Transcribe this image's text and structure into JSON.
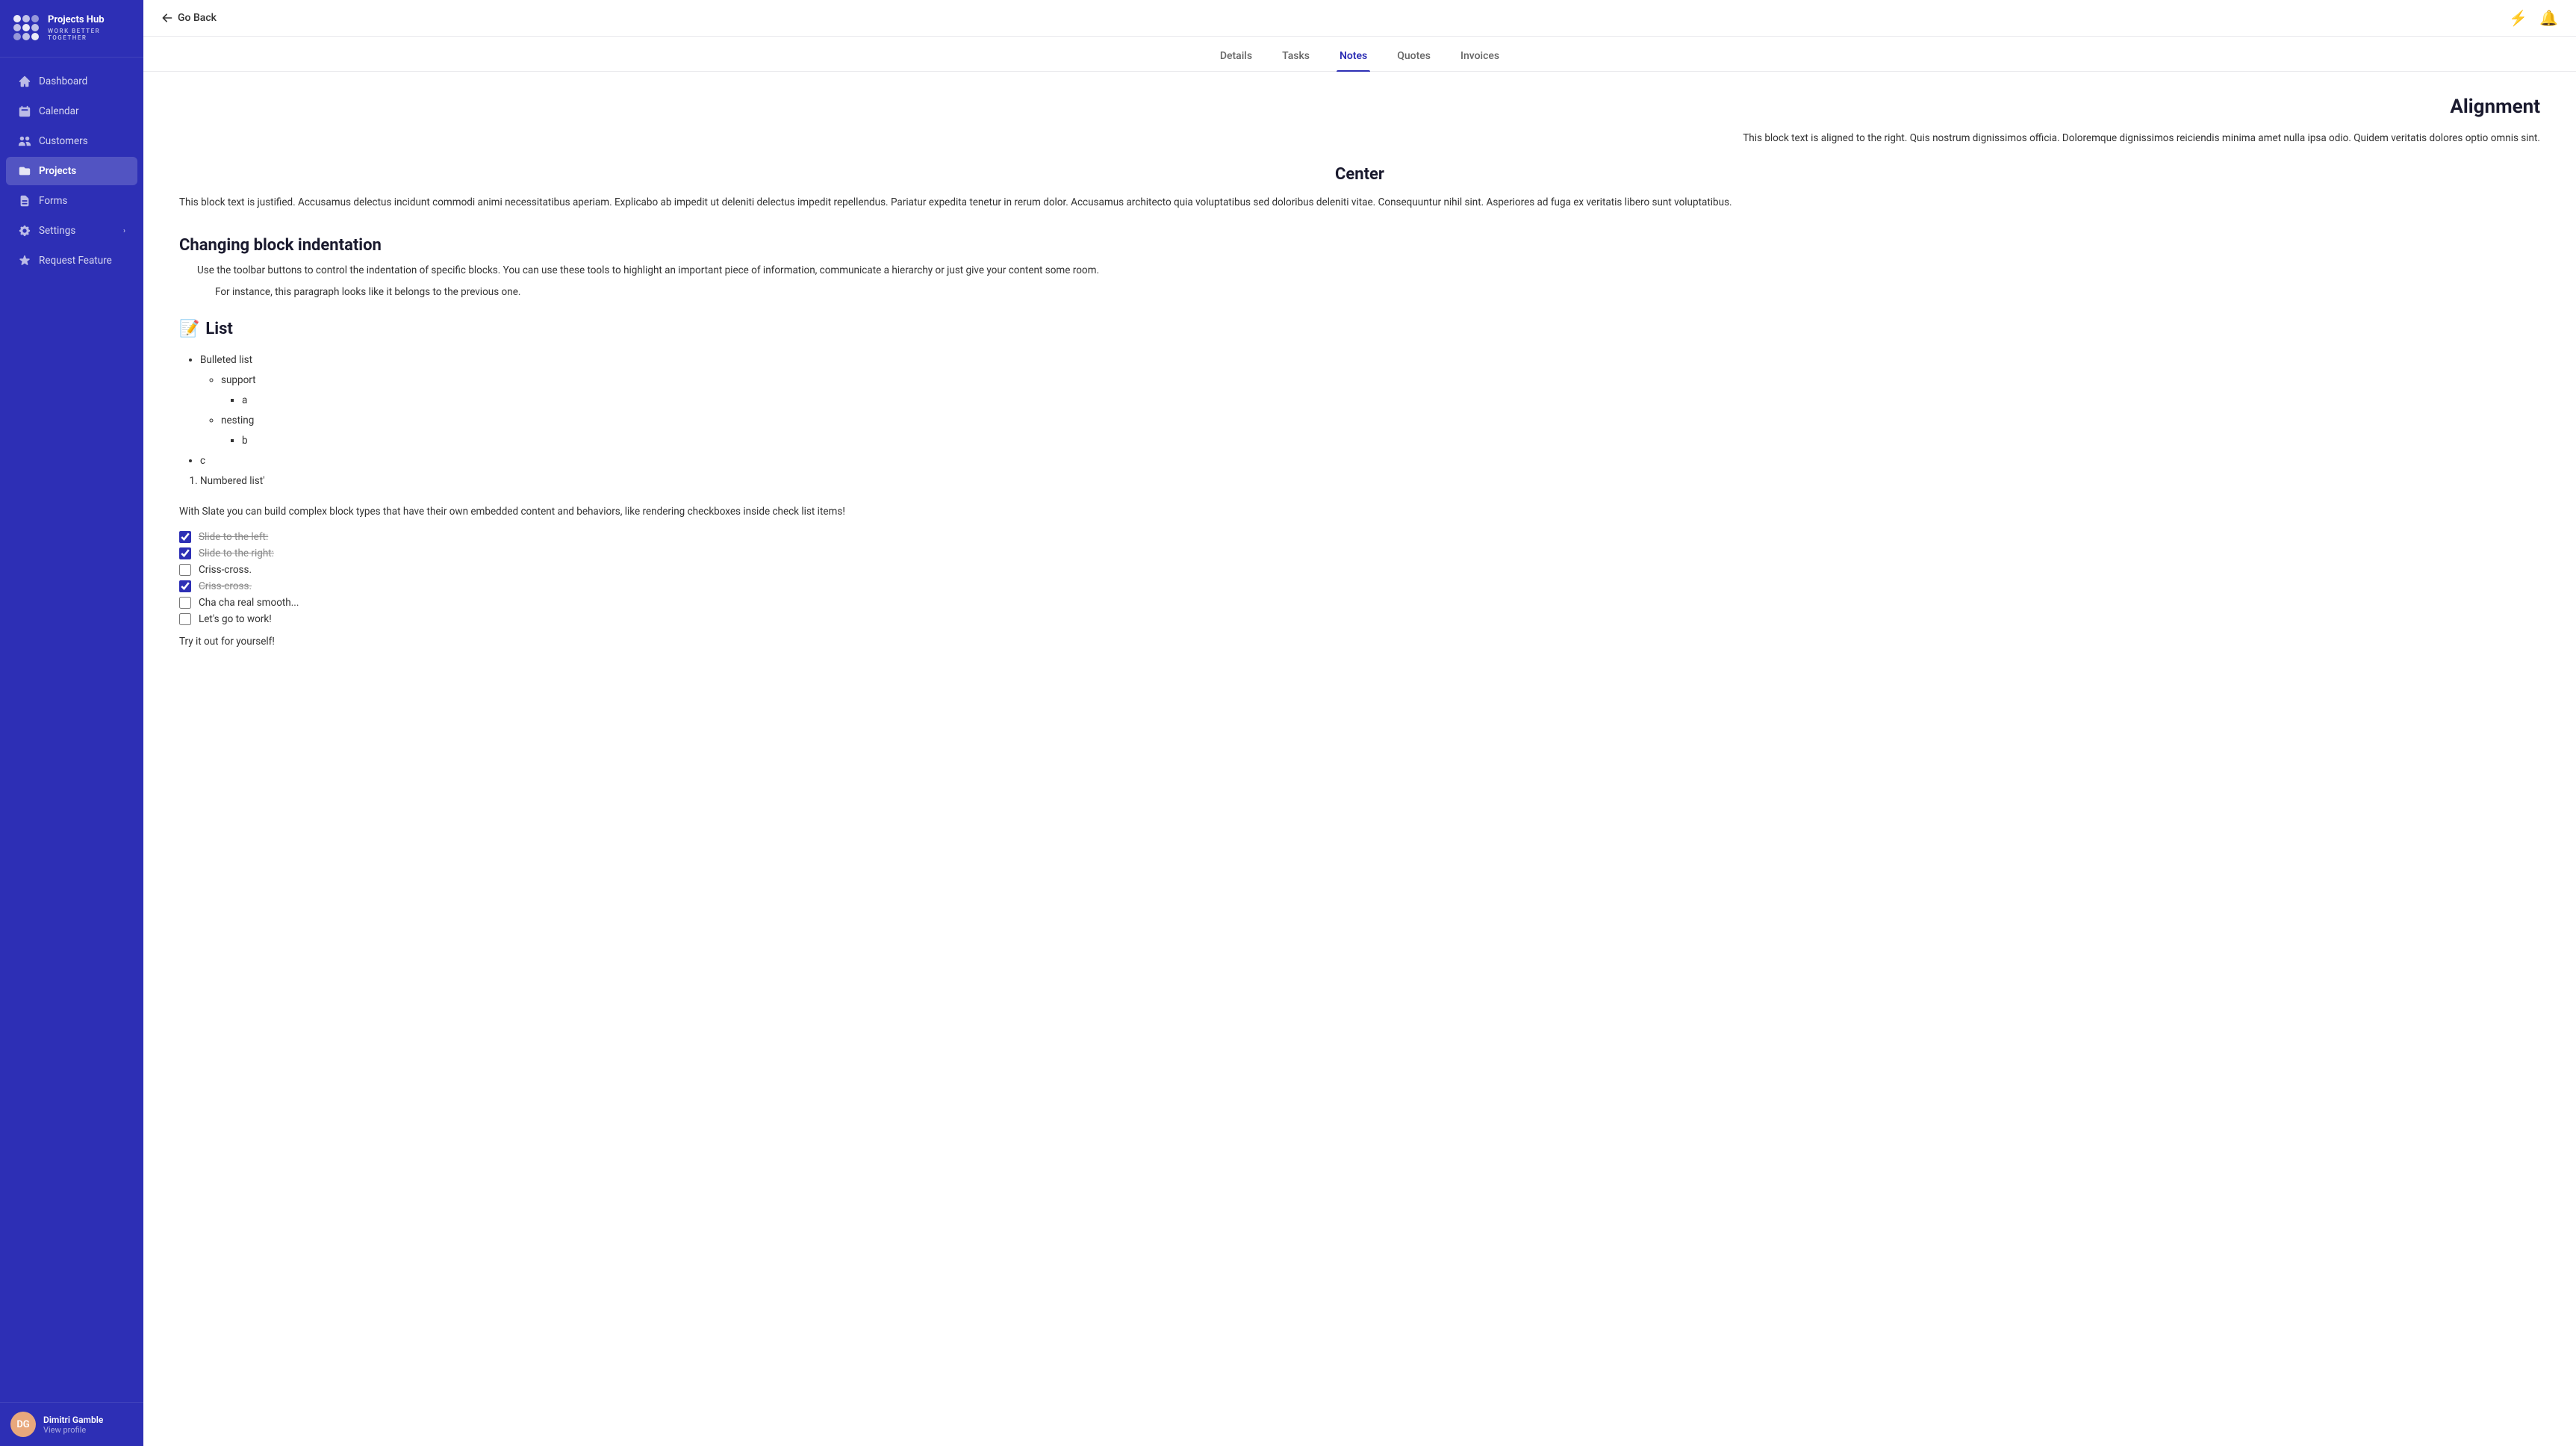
{
  "app": {
    "name": "Projects Hub",
    "tagline": "WORK BETTER TOGETHER"
  },
  "topbar": {
    "back_label": "Go Back"
  },
  "tabs": [
    {
      "id": "details",
      "label": "Details"
    },
    {
      "id": "tasks",
      "label": "Tasks"
    },
    {
      "id": "notes",
      "label": "Notes"
    },
    {
      "id": "quotes",
      "label": "Quotes"
    },
    {
      "id": "invoices",
      "label": "Invoices"
    }
  ],
  "sidebar": {
    "items": [
      {
        "id": "dashboard",
        "label": "Dashboard",
        "icon": "home"
      },
      {
        "id": "calendar",
        "label": "Calendar",
        "icon": "calendar"
      },
      {
        "id": "customers",
        "label": "Customers",
        "icon": "users"
      },
      {
        "id": "projects",
        "label": "Projects",
        "icon": "folder",
        "active": true
      },
      {
        "id": "forms",
        "label": "Forms",
        "icon": "file-text"
      },
      {
        "id": "settings",
        "label": "Settings",
        "icon": "settings",
        "hasChevron": true
      },
      {
        "id": "request-feature",
        "label": "Request Feature",
        "icon": "star"
      }
    ]
  },
  "user": {
    "name": "Dimitri Gamble",
    "initials": "DG",
    "profile_link": "View profile"
  },
  "content": {
    "alignment_heading": "Alignment",
    "right_text": "This block text is aligned to the right. Quis nostrum dignissimos officia. Doloremque dignissimos reiciendis minima amet nulla ipsa odio. Quidem veritatis dolores optio omnis sint.",
    "center_heading": "Center",
    "justified_text": "This block text is justified. Accusamus delectus incidunt commodi animi necessitatibus aperiam. Explicabo ab impedit ut deleniti delectus impedit repellendus. Pariatur expedita tenetur in rerum dolor. Accusamus architecto quia voluptatibus sed doloribus deleniti vitae. Consequuntur nihil sint. Asperiores ad fuga ex veritatis libero sunt voluptatibus.",
    "block_indent_heading": "Changing block indentation",
    "block_indent_para1": "Use the toolbar buttons to control the indentation of specific blocks. You can use these tools to highlight an important piece of information, communicate a hierarchy or just give your content some room.",
    "block_indent_para2": "For instance, this paragraph looks like it belongs to the previous one.",
    "list_emoji": "📝",
    "list_heading": "List",
    "list_items": {
      "bulleted": [
        {
          "text": "Bulleted list",
          "children": [
            {
              "text": "support",
              "children": [
                {
                  "text": "a"
                }
              ]
            },
            {
              "text": "nesting",
              "children": [
                {
                  "text": "b"
                }
              ]
            }
          ]
        },
        {
          "text": "c"
        }
      ],
      "numbered": [
        {
          "text": "Numbered list'"
        }
      ]
    },
    "with_slate_text": "With Slate you can build complex block types that have their own embedded content and behaviors, like rendering checkboxes inside check list items!",
    "checkboxes": [
      {
        "id": "cb1",
        "label": "Slide to the left:",
        "checked": true,
        "strikethrough": true
      },
      {
        "id": "cb2",
        "label": "Slide to the right:",
        "checked": true,
        "strikethrough": true
      },
      {
        "id": "cb3",
        "label": "Criss-cross.",
        "checked": false,
        "strikethrough": false
      },
      {
        "id": "cb4",
        "label": "Criss-cross.",
        "checked": true,
        "strikethrough": true
      },
      {
        "id": "cb5",
        "label": "Cha cha real smooth...",
        "checked": false,
        "strikethrough": false
      },
      {
        "id": "cb6",
        "label": "Let's go to work!",
        "checked": false,
        "strikethrough": false
      }
    ],
    "try_text": "Try it out for yourself!"
  }
}
